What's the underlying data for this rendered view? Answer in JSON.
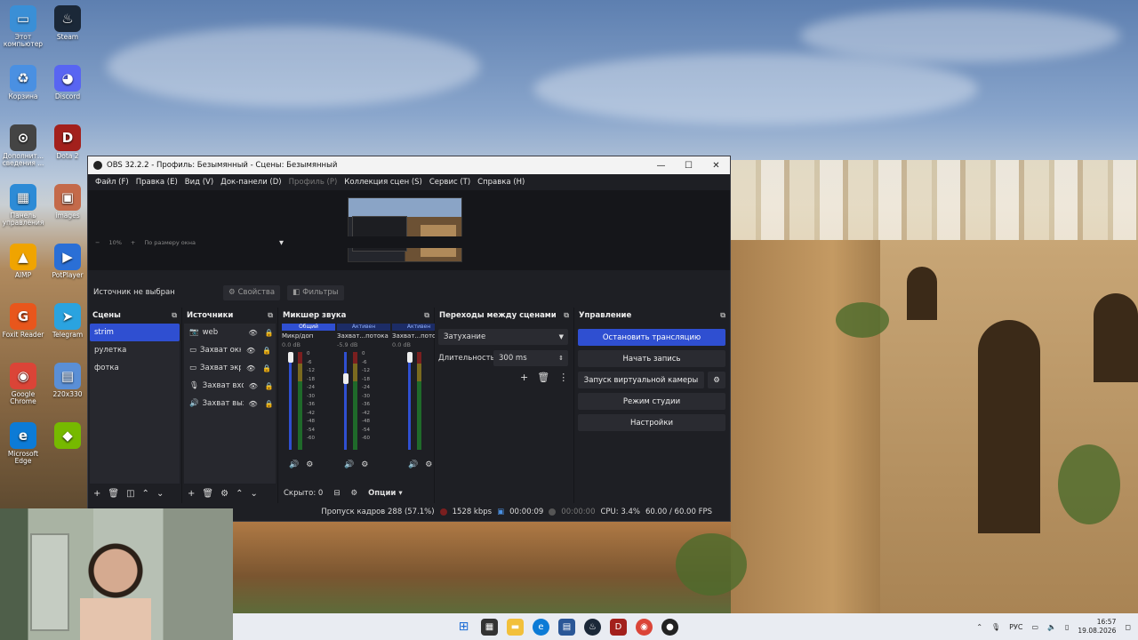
{
  "desktop": {
    "icons": [
      {
        "label": "Этот компьютер",
        "icon": "computer-icon",
        "color": "#3a8fd6"
      },
      {
        "label": "Steam",
        "icon": "steam-icon",
        "color": "#1b2838"
      },
      {
        "label": "Корзина",
        "icon": "recycle-bin-icon",
        "color": "#4a90e2"
      },
      {
        "label": "Discord",
        "icon": "discord-icon",
        "color": "#5865f2"
      },
      {
        "label": "Дополнит... сведения ...",
        "icon": "info-icon",
        "color": "#444444"
      },
      {
        "label": "Dota 2",
        "icon": "dota-icon",
        "color": "#a3201c"
      },
      {
        "label": "Панель управления",
        "icon": "control-panel-icon",
        "color": "#2d8bd6"
      },
      {
        "label": "images",
        "icon": "images-folder-icon",
        "color": "#c46a4a"
      },
      {
        "label": "AIMP",
        "icon": "aimp-icon",
        "color": "#f0a400"
      },
      {
        "label": "PotPlayer",
        "icon": "potplayer-icon",
        "color": "#2a6fd6"
      },
      {
        "label": "Foxit Reader",
        "icon": "foxit-icon",
        "color": "#e8561c"
      },
      {
        "label": "Telegram",
        "icon": "telegram-icon",
        "color": "#2aa3e0"
      },
      {
        "label": "Google Chrome",
        "icon": "chrome-icon",
        "color": "#db4437"
      },
      {
        "label": "220x330",
        "icon": "image-file-icon",
        "color": "#5a8fd6"
      },
      {
        "label": "Microsoft Edge",
        "icon": "edge-icon",
        "color": "#0c7bd6"
      },
      {
        "label": "",
        "icon": "nvidia-icon",
        "color": "#76b900"
      }
    ]
  },
  "window": {
    "title": "OBS 32.2.2 - Профиль: Безымянный - Сцены: Безымянный",
    "minimize": "—",
    "maximize": "☐",
    "close": "✕"
  },
  "menu": [
    "Файл (F)",
    "Правка (E)",
    "Вид (V)",
    "Док-панели (D)",
    "Профиль (P)",
    "Коллекция сцен (S)",
    "Сервис (T)",
    "Справка (H)"
  ],
  "zoom": {
    "minus": "−",
    "value": "10%",
    "plus": "+",
    "mode": "По размеру окна"
  },
  "source_bar": {
    "label": "Источник не выбран",
    "properties": "Свойства",
    "filters": "Фильтры"
  },
  "scenes": {
    "title": "Сцены",
    "items": [
      "strim",
      "рулетка",
      "фотка"
    ],
    "selected": "strim"
  },
  "sources": {
    "title": "Источники",
    "items": [
      {
        "name": "web",
        "icon": "camera-icon"
      },
      {
        "name": "Захват окна",
        "icon": "window-capture-icon"
      },
      {
        "name": "Захват экрана",
        "icon": "display-capture-icon"
      },
      {
        "name": "Захват входного аудио",
        "icon": "microphone-icon"
      },
      {
        "name": "Захват выходного аудио",
        "icon": "speaker-icon"
      }
    ]
  },
  "mixer": {
    "title": "Микшер звука",
    "channels": [
      {
        "tag": "Общий",
        "name": "Микр/доп",
        "db": "0.0 dB",
        "level": 0.98,
        "meter": 0.55
      },
      {
        "tag": "Активен",
        "name": "Захват...потока",
        "db": "-5.9 dB",
        "level": 0.7,
        "meter": 0.72
      },
      {
        "tag": "Активен",
        "name": "Захват...потока",
        "db": "0.0 dB",
        "level": 0.98,
        "meter": 0.8
      }
    ],
    "scale": [
      "0",
      "-6",
      "-12",
      "-18",
      "-24",
      "-30",
      "-36",
      "-42",
      "-48",
      "-54",
      "-60"
    ],
    "hidden": "Скрыто: 0",
    "options": "Опции"
  },
  "transitions": {
    "title": "Переходы между сценами",
    "type": "Затухание",
    "duration_label": "Длительность",
    "duration": "300 ms"
  },
  "controls": {
    "title": "Управление",
    "stop_stream": "Остановить трансляцию",
    "start_record": "Начать запись",
    "virtual_camera": "Запуск виртуальной камеры",
    "studio_mode": "Режим студии",
    "settings": "Настройки"
  },
  "status": {
    "dropped": "Пропуск кадров 288 (57.1%)",
    "bitrate": "1528 kbps",
    "stream_time": "00:00:09",
    "record_time": "00:00:00",
    "cpu": "CPU: 3.4%",
    "fps": "60.00 / 60.00 FPS"
  },
  "taskbar": {
    "lang": "РУС",
    "time": "16:57",
    "date": "19.08.2026"
  }
}
